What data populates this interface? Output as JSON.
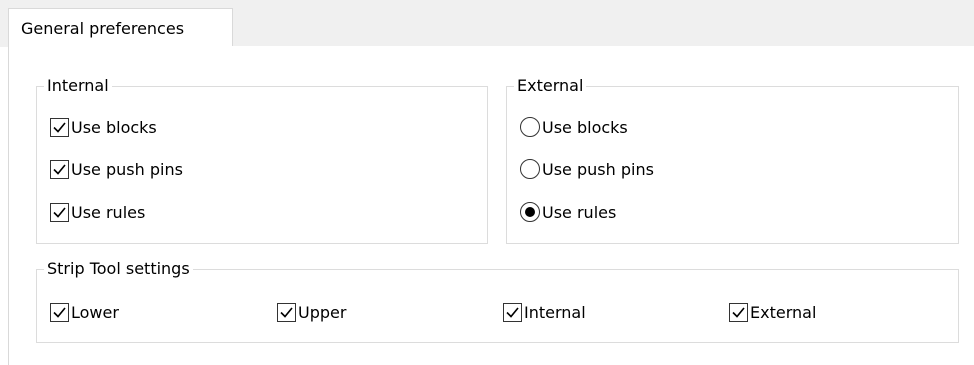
{
  "tabs": [
    {
      "label": "General preferences",
      "selected": true
    }
  ],
  "internal": {
    "title": "Internal",
    "items": [
      {
        "label": "Use blocks",
        "checked": false
      },
      {
        "label": "Use push pins",
        "checked": false
      },
      {
        "label": "Use rules",
        "checked": true
      }
    ]
  },
  "external": {
    "title": "External",
    "items": [
      {
        "label": "Use blocks",
        "selected": false
      },
      {
        "label": "Use push pins",
        "selected": false
      },
      {
        "label": "Use rules",
        "selected": true
      }
    ]
  },
  "strip_tool": {
    "title": "Strip Tool settings",
    "items": [
      {
        "label": "Lower",
        "checked": true
      },
      {
        "label": "Upper",
        "checked": true
      },
      {
        "label": "Internal",
        "checked": true
      },
      {
        "label": "External",
        "checked": true
      }
    ]
  },
  "colors": {
    "border": "#dcdcdc",
    "tabstrip_bg": "#f0f0f0",
    "control_border": "#333333"
  }
}
